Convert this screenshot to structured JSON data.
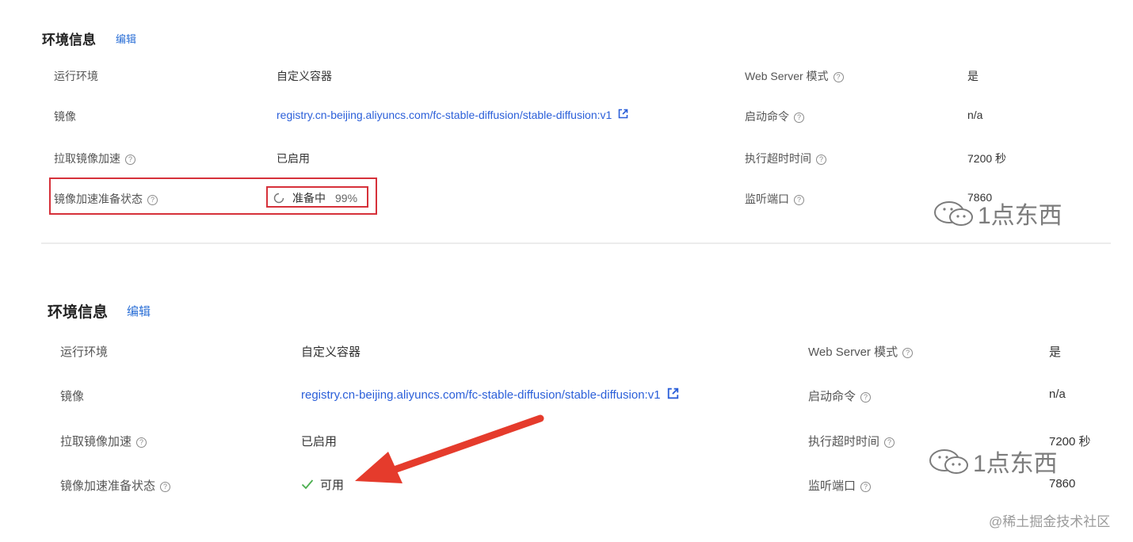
{
  "panel1": {
    "title": "环境信息",
    "edit": "编辑",
    "rows": {
      "runtime": {
        "label": "运行环境",
        "value": "自定义容器"
      },
      "image": {
        "label": "镜像",
        "value": "registry.cn-beijing.aliyuncs.com/fc-stable-diffusion/stable-diffusion:v1"
      },
      "accel": {
        "label": "拉取镜像加速",
        "value": "已启用"
      },
      "status": {
        "label": "镜像加速准备状态",
        "value": "准备中",
        "percent": "99%"
      },
      "webserver": {
        "label": "Web Server 模式",
        "value": "是"
      },
      "startcmd": {
        "label": "启动命令",
        "value": "n/a"
      },
      "timeout": {
        "label": "执行超时时间",
        "value": "7200 秒"
      },
      "port": {
        "label": "监听端口",
        "value": "7860"
      }
    }
  },
  "panel2": {
    "title": "环境信息",
    "edit": "编辑",
    "rows": {
      "runtime": {
        "label": "运行环境",
        "value": "自定义容器"
      },
      "image": {
        "label": "镜像",
        "value": "registry.cn-beijing.aliyuncs.com/fc-stable-diffusion/stable-diffusion:v1"
      },
      "accel": {
        "label": "拉取镜像加速",
        "value": "已启用"
      },
      "status": {
        "label": "镜像加速准备状态",
        "value": "可用"
      },
      "webserver": {
        "label": "Web Server 模式",
        "value": "是"
      },
      "startcmd": {
        "label": "启动命令",
        "value": "n/a"
      },
      "timeout": {
        "label": "执行超时时间",
        "value": "7200 秒"
      },
      "port": {
        "label": "监听端口",
        "value": "7860"
      }
    }
  },
  "watermark": {
    "text": "1点东西"
  },
  "credit": "@稀土掘金技术社区",
  "colors": {
    "link": "#2b5fd9",
    "highlight": "#d6313a",
    "success": "#4caf50",
    "arrow": "#e53b2c"
  },
  "icons": {
    "help": "help-circle-icon",
    "external": "external-link-icon",
    "loading": "loading-spinner-icon",
    "check": "check-icon",
    "wechat": "wechat-icon"
  }
}
